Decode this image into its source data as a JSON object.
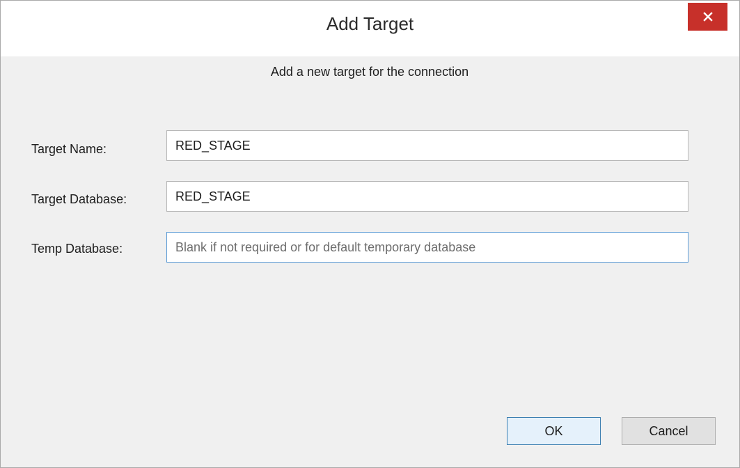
{
  "window": {
    "title": "Add Target",
    "close_icon": "close-icon"
  },
  "dialog": {
    "subtitle": "Add a new target for the connection"
  },
  "fields": {
    "target_name": {
      "label": "Target Name:",
      "value": "RED_STAGE",
      "placeholder": ""
    },
    "target_database": {
      "label": "Target Database:",
      "value": "RED_STAGE",
      "placeholder": ""
    },
    "temp_database": {
      "label": "Temp Database:",
      "value": "",
      "placeholder": "Blank if not required or for default temporary database"
    }
  },
  "buttons": {
    "ok_label": "OK",
    "cancel_label": "Cancel"
  },
  "colors": {
    "close_button_bg": "#c7302a",
    "focus_border": "#5b9bd5",
    "default_button_border": "#3c7fb1"
  }
}
